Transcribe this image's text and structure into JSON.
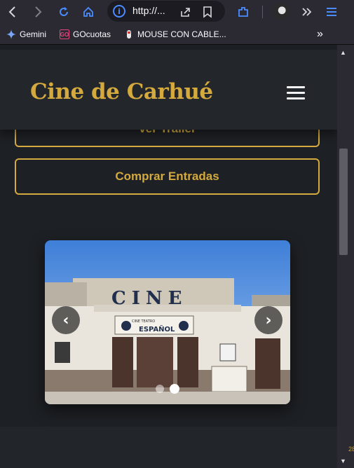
{
  "browser": {
    "url": "http://...",
    "icons": [
      "back-icon",
      "forward-icon",
      "reload-icon",
      "home-icon",
      "info-icon",
      "share-icon",
      "bookmark-icon",
      "extension-icon",
      "avatar",
      "overflow-icon",
      "menu-icon"
    ],
    "colors": {
      "toolbar_bg": "#2b2a33",
      "accent": "#4a8cff"
    }
  },
  "bookmarks": {
    "items": [
      {
        "label": "Gemini",
        "icon": "gemini-icon"
      },
      {
        "label": "GOcuotas",
        "icon": "gocuotas-icon"
      },
      {
        "label": "MOUSE CON CABLE...",
        "icon": "mouse-product-icon"
      }
    ],
    "more": "»"
  },
  "site": {
    "title": "Cine de Carhué",
    "colors": {
      "gold": "#d4a93d",
      "page_bg": "#1d2024",
      "header_bg": "#23262b"
    }
  },
  "actions": {
    "trailer_label": "Ver Trailer",
    "tickets_label": "Comprar Entradas"
  },
  "carousel": {
    "image": {
      "marquee": "CINE",
      "sign_line": "CINE TEATRO",
      "sign_name": "ESPAÑOL"
    },
    "prev": "‹",
    "next": "›",
    "slides": 2,
    "active_slide": 2
  },
  "edge_text": "28"
}
